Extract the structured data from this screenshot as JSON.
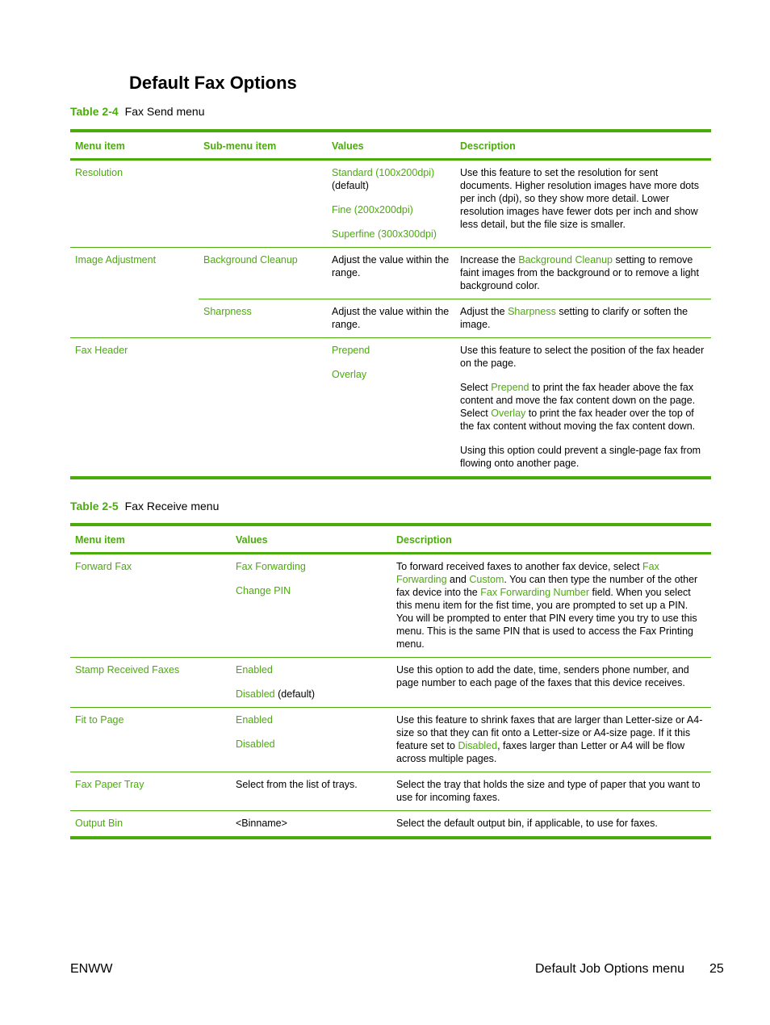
{
  "page_title": "Default Fax Options",
  "table1": {
    "number": "Table 2-4",
    "title": "Fax Send menu",
    "headers": [
      "Menu item",
      "Sub-menu item",
      "Values",
      "Description"
    ],
    "rows": [
      {
        "menu_item": "Resolution",
        "sub_menu_item": "",
        "values": [
          {
            "text": "Standard (100x200dpi)",
            "suffix": "(default)"
          },
          {
            "text": "Fine (200x200dpi)"
          },
          {
            "text": "Superfine (300x300dpi)"
          }
        ],
        "description": "Use this feature to set the resolution for sent documents. Higher resolution images have more dots per inch (dpi), so they show more detail. Lower resolution images have fewer dots per inch and show less detail, but the file size is smaller."
      },
      {
        "menu_item": "Image Adjustment",
        "sub_menu_item": "Background Cleanup",
        "values_text": "Adjust the value within the range.",
        "description_pre": "Increase the ",
        "description_link": "Background Cleanup",
        "description_post": " setting to remove faint images from the background or to remove a light background color."
      },
      {
        "menu_item": "",
        "sub_menu_item": "Sharpness",
        "values_text": "Adjust the value within the range.",
        "description_pre": "Adjust the ",
        "description_link": "Sharpness",
        "description_post": " setting to clarify or soften the image."
      },
      {
        "menu_item": "Fax Header",
        "sub_menu_item": "",
        "values": [
          "Prepend",
          "Overlay"
        ],
        "description_p1": "Use this feature to select the position of the fax header on the page.",
        "description_p2_a": "Select ",
        "description_p2_link1": "Prepend",
        "description_p2_b": " to print the fax header above the fax content and move the fax content down on the page. Select ",
        "description_p2_link2": "Overlay",
        "description_p2_c": " to print the fax header over the top of the fax content without moving the fax content down.",
        "description_p3": "Using this option could prevent a single-page fax from flowing onto another page."
      }
    ]
  },
  "table2": {
    "number": "Table 2-5",
    "title": "Fax Receive menu",
    "headers": [
      "Menu item",
      "Values",
      "Description"
    ],
    "rows": [
      {
        "menu_item": "Forward Fax",
        "values": [
          "Fax Forwarding",
          "Change PIN"
        ],
        "d_a": "To forward received faxes to another fax device, select ",
        "d_link1": "Fax Forwarding",
        "d_b": " and ",
        "d_link2": "Custom",
        "d_c": ". You can then type the number of the other fax device into the ",
        "d_link3": "Fax Forwarding Number",
        "d_d": " field. When you select this menu item for the fist time, you are prompted to set up a PIN. You will be prompted to enter that PIN every time you try to use this menu. This is the same PIN that is used to access the Fax Printing menu."
      },
      {
        "menu_item": "Stamp Received Faxes",
        "values": [
          "Enabled",
          "Disabled"
        ],
        "default_suffix": "(default)",
        "description": "Use this option to add the date, time, senders phone number, and page number to each page of the faxes that this device receives."
      },
      {
        "menu_item": "Fit to Page",
        "values": [
          "Enabled",
          "Disabled"
        ],
        "d_a": "Use this feature to shrink faxes that are larger than Letter-size or A4-size so that they can fit onto a Letter-size or A4-size page. If it this feature set to ",
        "d_link1": "Disabled",
        "d_b": ", faxes larger than Letter or A4 will be flow across multiple pages."
      },
      {
        "menu_item": "Fax Paper Tray",
        "values_text": "Select from the list of trays.",
        "description": "Select the tray that holds the size and type of paper that you want to use for incoming faxes."
      },
      {
        "menu_item": "Output Bin",
        "values_text": "<Binname>",
        "description": "Select the default output bin, if applicable, to use for faxes."
      }
    ]
  },
  "footer": {
    "left": "ENWW",
    "section": "Default Job Options menu",
    "page_number": "25"
  },
  "colors": {
    "accent": "#4bab0c"
  }
}
